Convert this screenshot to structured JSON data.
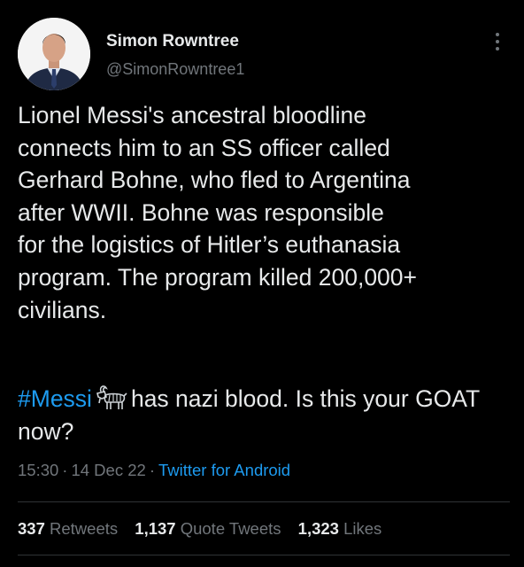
{
  "author": {
    "display_name": "Simon Rowntree",
    "handle": "@SimonRowntree1",
    "avatar_icon": "profile-photo"
  },
  "tweet": {
    "body": "Lionel Messi's ancestral bloodline\nconnects him to an SS officer called\nGerhard Bohne, who fled to Argentina\nafter WWII. Bohne was responsible\nfor the logistics of Hitler’s euthanasia\nprogram. The program killed 200,000+\ncivilians.",
    "hashtag": "#Messi",
    "emoji_icon": "goat-emoji",
    "second_text": "has nazi blood. Is this your GOAT now?"
  },
  "meta": {
    "time": "15:30",
    "separator": "·",
    "date": "14 Dec 22",
    "source": "Twitter for Android"
  },
  "stats": {
    "retweets": {
      "count": "337",
      "label": "Retweets"
    },
    "quote_tweets": {
      "count": "1,137",
      "label": "Quote Tweets"
    },
    "likes": {
      "count": "1,323",
      "label": "Likes"
    }
  },
  "colors": {
    "background": "#000000",
    "text": "#e7e9ea",
    "secondary_text": "#71767b",
    "accent": "#1d9bf0",
    "divider": "#2f3336"
  },
  "icons": {
    "more": "more-vertical-icon"
  }
}
